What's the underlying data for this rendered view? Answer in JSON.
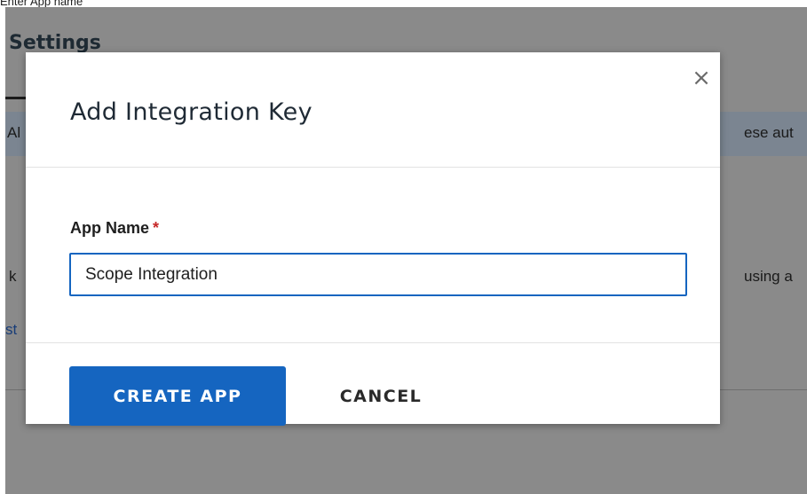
{
  "caption": "Enter App name",
  "background": {
    "title": "Settings",
    "alert_left_fragment": "Al",
    "alert_right_fragment": "ese aut",
    "text_left_fragment": "k",
    "text_right_fragment": "using a",
    "link_fragment": "st"
  },
  "modal": {
    "title": "Add Integration Key",
    "close_glyph": "×",
    "field": {
      "label": "App Name",
      "required_mark": "*",
      "value": "Scope Integration"
    },
    "buttons": {
      "create": "CREATE APP",
      "cancel": "CANCEL"
    }
  },
  "colors": {
    "primary": "#1565c0",
    "required": "#c62828",
    "overlay": "#8a8a8a"
  }
}
